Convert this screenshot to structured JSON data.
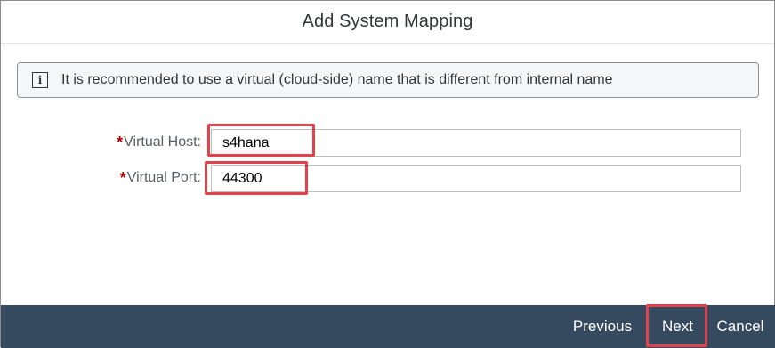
{
  "dialog": {
    "title": "Add System Mapping"
  },
  "info": {
    "icon": "info-icon",
    "icon_glyph": "i",
    "message": "It is recommended to use a virtual (cloud-side) name that is different from internal name"
  },
  "form": {
    "required_marker": "*",
    "virtual_host": {
      "label": "Virtual Host:",
      "value": "s4hana"
    },
    "virtual_port": {
      "label": "Virtual Port:",
      "value": "44300"
    }
  },
  "footer": {
    "previous_label": "Previous",
    "next_label": "Next",
    "cancel_label": "Cancel"
  },
  "colors": {
    "footer_bg": "#354a5f",
    "required": "#bb0000",
    "highlight": "#e2424b"
  }
}
